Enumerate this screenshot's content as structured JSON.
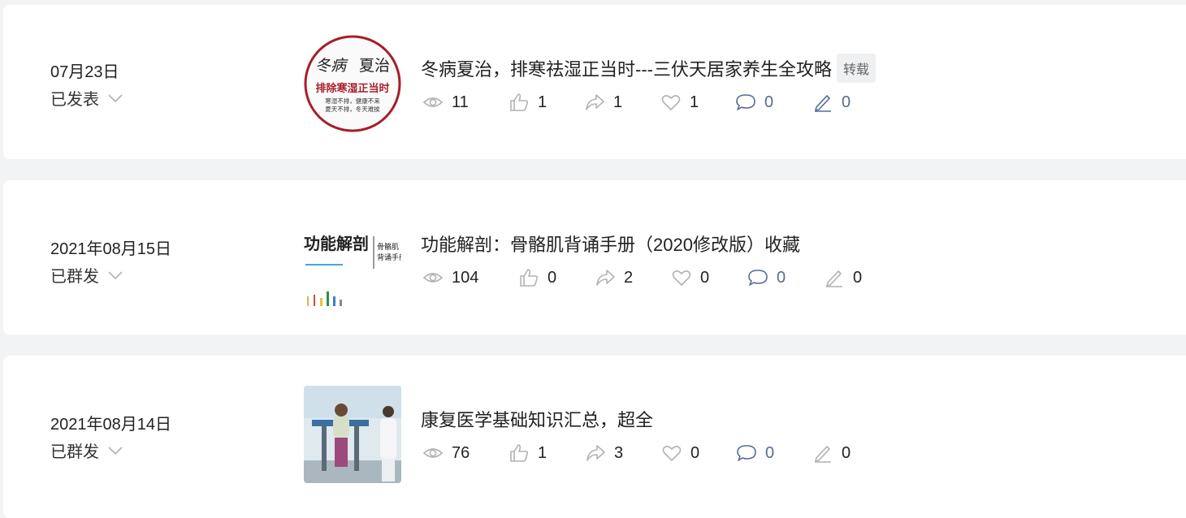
{
  "posts": [
    {
      "date": "07月23日",
      "status": "已发表",
      "title": "冬病夏治，排寒祛湿正当时---三伏天居家养生全攻略",
      "tag": "转载",
      "thumb": {
        "line1a": "冬病",
        "line1b": "夏治",
        "line2": "排除寒湿正当时",
        "line3": "寒湿不排，健康不来",
        "line4": "夏天不排，冬天难挨"
      },
      "stats": {
        "views": "11",
        "likes": "1",
        "shares": "1",
        "favorites": "1",
        "comments": "0",
        "edits": "0"
      }
    },
    {
      "date": "2021年08月15日",
      "status": "已群发",
      "title": "功能解剖：骨骼肌背诵手册（2020修改版）收藏",
      "tag": "",
      "thumb": {
        "main": "功能解剖",
        "side1": "骨骼肌",
        "side2": "背诵手册"
      },
      "stats": {
        "views": "104",
        "likes": "0",
        "shares": "2",
        "favorites": "0",
        "comments": "0",
        "edits": "0"
      }
    },
    {
      "date": "2021年08月14日",
      "status": "已群发",
      "title": "康复医学基础知识汇总，超全",
      "tag": "",
      "thumb": {},
      "stats": {
        "views": "76",
        "likes": "1",
        "shares": "3",
        "favorites": "0",
        "comments": "0",
        "edits": "0"
      }
    }
  ],
  "icons": [
    "eye-icon",
    "thumbs-up-icon",
    "share-icon",
    "heart-icon",
    "comment-icon",
    "pencil-icon",
    "chevron-down-icon"
  ],
  "colors": {
    "comment_blue": "#576b95",
    "icon_gray": "#b2b2b2",
    "text": "#222222",
    "seal_red": "#a51f2a"
  }
}
